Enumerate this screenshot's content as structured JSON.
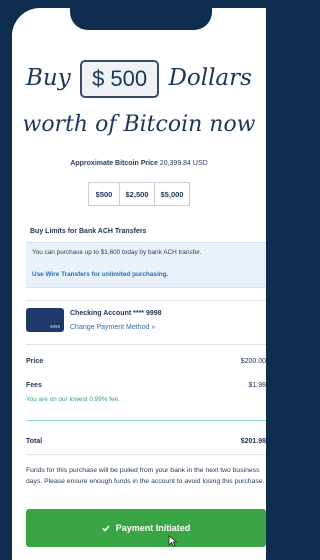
{
  "headline": {
    "prefix": "Buy",
    "amount": "$ 500",
    "suffix": "Dollars",
    "line2": "worth of Bitcoin now"
  },
  "price": {
    "label": "Approximate Bitcoin Price",
    "value": "20,399.84 USD"
  },
  "presets": [
    "$500",
    "$2,500",
    "$5,000"
  ],
  "limits": {
    "title": "Buy Limits for Bank ACH Transfers",
    "message": "You can purchase up to $1,600 today by bank ACH transfer.",
    "wire_link": "Use Wire Transfers for unlimited purchasing."
  },
  "account": {
    "card_number": "9998",
    "name": "Checking Account **** 9998",
    "change_link": "Change Payment Method »"
  },
  "summary": {
    "price_label": "Price",
    "price_value": "$200.00",
    "fees_label": "Fees",
    "fees_value": "$1.98",
    "fee_note": "You are on our lowest 0.99% fee.",
    "total_label": "Total",
    "total_value": "$201.98"
  },
  "notice": "Funds for this purchase will be pulled from your bank in the next two business days. Please ensure enough funds in the account to avoid losing this purchase.",
  "cta": {
    "label": "Payment Initiated"
  },
  "colors": {
    "frame": "#0f2d4f",
    "accent_link": "#2a6db5",
    "success": "#3aa544",
    "fee_note": "#2aa877"
  }
}
